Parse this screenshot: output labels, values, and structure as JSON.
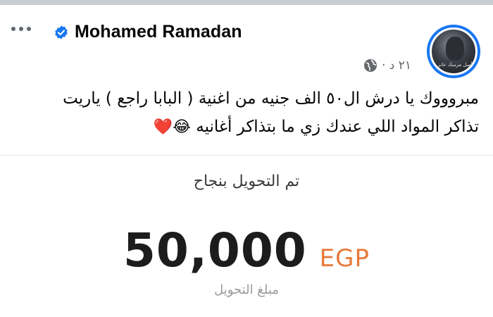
{
  "post": {
    "author": "Mohamed Ramadan",
    "time": "٢١ د ·",
    "avatar_caption": "أصل مرسك عانز",
    "text_line1": "مبروووك يا درش ال٥٠ الف جنيه من اغنية ( البابا راجع ) ياريت",
    "text_line2": "تذاكر المواد اللي عندك زي ما بتذاكر أغانيه",
    "text_emoji": "😂❤️"
  },
  "transfer": {
    "title": "تم التحويل بنجاح",
    "amount": "50,000",
    "currency": "EGP",
    "amount_label": "مبلغ التحويل"
  },
  "colors": {
    "verified_blue": "#1877f2",
    "currency_orange": "#e87a3a",
    "meta_gray": "#65676b"
  },
  "icons": [
    "more-icon",
    "verified-badge-icon",
    "globe-icon"
  ]
}
